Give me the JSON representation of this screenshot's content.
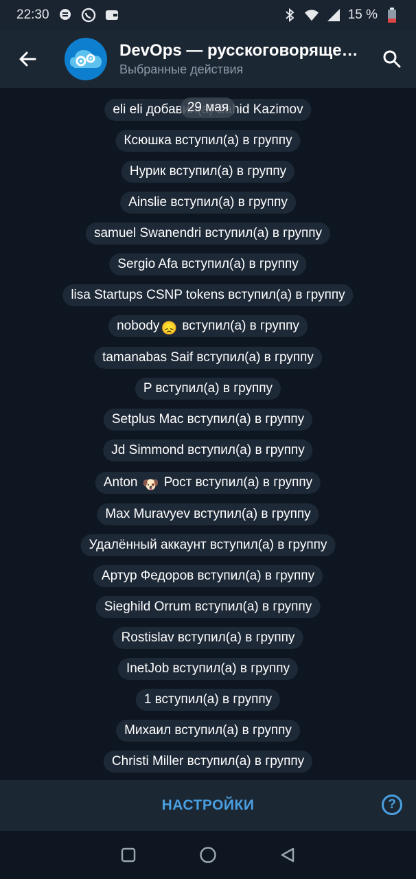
{
  "status_bar": {
    "time": "22:30",
    "battery": "15 %",
    "icons": [
      "chat-bubble-icon",
      "whatsapp-icon",
      "wallet-icon",
      "bluetooth-icon",
      "wifi-icon",
      "signal-icon",
      "battery-icon"
    ]
  },
  "header": {
    "title": "DevOps — русскоговорящее сообщество",
    "subtitle": "Выбранные действия"
  },
  "date_label": "29 мая",
  "messages": [
    {
      "text": "eli eli добавил(а) Zahid Kazimov"
    },
    {
      "text": "Ксюшка вступил(а) в группу"
    },
    {
      "text": "Нурик вступил(а) в группу"
    },
    {
      "text": "Ainslie вступил(а) в группу"
    },
    {
      "text": "samuel Swanendri вступил(а) в группу"
    },
    {
      "text": "Sergio Afa вступил(а) в группу"
    },
    {
      "text": "lisa Startups CSNP tokens вступил(а) в группу"
    },
    {
      "pre": "nobody",
      "emoji": "😞",
      "post": " вступил(а) в группу"
    },
    {
      "text": "tamanabas Saif вступил(а) в группу"
    },
    {
      "text": "P вступил(а) в группу"
    },
    {
      "text": "Setplus Mac вступил(а) в группу"
    },
    {
      "text": "Jd Simmond вступил(а) в группу"
    },
    {
      "pre": "Anton ",
      "emoji": "🐶",
      "post": " Рост вступил(а) в группу"
    },
    {
      "text": "Max Muravyev вступил(а) в группу"
    },
    {
      "text": "Удалённый аккаунт вступил(а) в группу"
    },
    {
      "text": "Артур Федоров вступил(а) в группу"
    },
    {
      "text": "Sieghild Orrum вступил(а) в группу"
    },
    {
      "text": "Rostislav вступил(а) в группу"
    },
    {
      "text": "InetJob вступил(а) в группу"
    },
    {
      "text": "1 вступил(а) в группу"
    },
    {
      "text": "Михаил вступил(а) в группу"
    },
    {
      "text": "Christi Miller вступил(а) в группу"
    }
  ],
  "bottom": {
    "settings_label": "НАСТРОЙКИ",
    "help_label": "?"
  },
  "colors": {
    "background": "#0e1621",
    "bar": "#1c2734",
    "pill": "#1e2937",
    "accent": "#4a9fe0"
  }
}
